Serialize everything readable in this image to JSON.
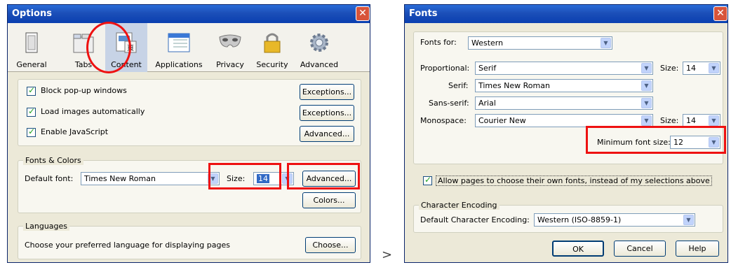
{
  "options": {
    "title": "Options",
    "tabs": [
      {
        "label": "General",
        "icon": "general-icon"
      },
      {
        "label": "Tabs",
        "icon": "tabs-icon"
      },
      {
        "label": "Content",
        "icon": "content-icon"
      },
      {
        "label": "Applications",
        "icon": "applications-icon"
      },
      {
        "label": "Privacy",
        "icon": "privacy-mask-icon"
      },
      {
        "label": "Security",
        "icon": "lock-icon"
      },
      {
        "label": "Advanced",
        "icon": "gear-icon"
      }
    ],
    "checks": [
      {
        "label": "Block pop-up windows",
        "button": "Exceptions..."
      },
      {
        "label": "Load images automatically",
        "button": "Exceptions..."
      },
      {
        "label": "Enable JavaScript",
        "button": "Advanced..."
      }
    ],
    "fonts_colors": {
      "title": "Fonts & Colors",
      "default_font_label": "Default font:",
      "default_font_value": "Times New Roman",
      "size_label": "Size:",
      "size_value": "14",
      "advanced_button": "Advanced...",
      "colors_button": "Colors..."
    },
    "languages": {
      "title": "Languages",
      "text": "Choose your preferred language for displaying pages",
      "choose_button": "Choose..."
    }
  },
  "separator": ">",
  "fonts": {
    "title": "Fonts",
    "fonts_for_label": "Fonts for:",
    "fonts_for_value": "Western",
    "proportional_label": "Proportional:",
    "proportional_value": "Serif",
    "serif_label": "Serif:",
    "serif_value": "Times New Roman",
    "sans_label": "Sans-serif:",
    "sans_value": "Arial",
    "mono_label": "Monospace:",
    "mono_value": "Courier New",
    "size_label": "Size:",
    "prop_size": "14",
    "mono_size": "14",
    "min_size_label": "Minimum font size:",
    "min_size_value": "12",
    "allow_label": "Allow pages to choose their own fonts, instead of my selections above",
    "encoding_title": "Character Encoding",
    "encoding_label": "Default Character Encoding:",
    "encoding_value": "Western (ISO-8859-1)",
    "ok": "OK",
    "cancel": "Cancel",
    "help": "Help"
  },
  "colors": {
    "accent_red": "#ee1111",
    "title_blue": "#0a3fb0"
  }
}
